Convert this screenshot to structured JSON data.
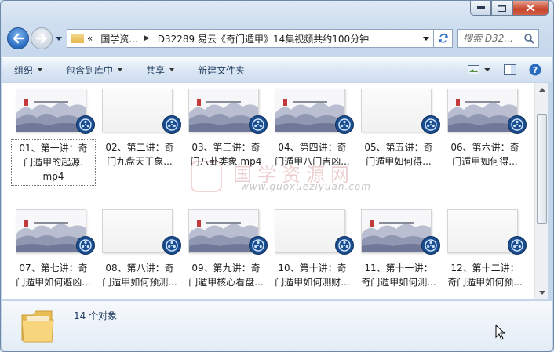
{
  "window": {
    "colors": {
      "frame": "#c4d6ec",
      "accent": "#2a6bc2",
      "close": "#c7442b",
      "badge": "#1a4d8f"
    }
  },
  "address": {
    "overflow": "«",
    "crumbs": [
      "国学资...",
      "D32289 易云《奇门遁甲》14集视频共约100分钟"
    ]
  },
  "search": {
    "placeholder": "搜索 D32..."
  },
  "toolbar": {
    "organize": "组织",
    "include_in_library": "包含到库中",
    "share": "共享",
    "new_folder": "新建文件夹"
  },
  "watermark": {
    "title": "国学资源网",
    "url": "www.guoxueziyuan.com"
  },
  "files": [
    {
      "name": "01、第一讲：奇门遁甲的起源.mp4",
      "line1": "01、第一讲：奇",
      "line2": "门遁甲的起源.",
      "line3": "mp4",
      "thumb": "landscape",
      "selected": true
    },
    {
      "name": "02、第二讲：奇门九盘天干象...",
      "line1": "02、第二讲：奇",
      "line2": "门九盘天干象...",
      "line3": "",
      "thumb": "blank",
      "selected": false
    },
    {
      "name": "03、第三讲：奇门八卦类象.mp4",
      "line1": "03、第三讲：奇",
      "line2": "门八卦类象.mp4",
      "line3": "",
      "thumb": "landscape",
      "selected": false
    },
    {
      "name": "04、第四讲：奇门遁甲八门吉凶...",
      "line1": "04、第四讲：奇",
      "line2": "门遁甲八门吉凶...",
      "line3": "",
      "thumb": "landscape",
      "selected": false
    },
    {
      "name": "05、第五讲：奇门遁甲如何得...",
      "line1": "05、第五讲：奇",
      "line2": "门遁甲如何得...",
      "line3": "",
      "thumb": "blank",
      "selected": false
    },
    {
      "name": "06、第六讲：奇门遁甲如何得...",
      "line1": "06、第六讲：奇",
      "line2": "门遁甲如何得...",
      "line3": "",
      "thumb": "landscape",
      "selected": false
    },
    {
      "name": "07、第七讲：奇门遁甲如何避凶...",
      "line1": "07、第七讲：奇",
      "line2": "门遁甲如何避凶...",
      "line3": "",
      "thumb": "landscape",
      "selected": false
    },
    {
      "name": "08、第八讲：奇门遁甲如何预测...",
      "line1": "08、第八讲：奇",
      "line2": "门遁甲如何预测...",
      "line3": "",
      "thumb": "blank",
      "selected": false
    },
    {
      "name": "09、第九讲：奇门遁甲核心看盘...",
      "line1": "09、第九讲：奇",
      "line2": "门遁甲核心看盘...",
      "line3": "",
      "thumb": "landscape",
      "selected": false
    },
    {
      "name": "10、第十讲：奇门遁甲如何测财...",
      "line1": "10、第十讲：奇",
      "line2": "门遁甲如何测财...",
      "line3": "",
      "thumb": "blank",
      "selected": false
    },
    {
      "name": "11、第十一讲：奇门遁甲如何测...",
      "line1": "11、第十一讲：",
      "line2": "奇门遁甲如何测...",
      "line3": "",
      "thumb": "landscape",
      "selected": false
    },
    {
      "name": "12、第十二讲：奇门遁甲如何预...",
      "line1": "12、第十二讲：",
      "line2": "奇门遁甲如何预...",
      "line3": "",
      "thumb": "blank",
      "selected": false
    }
  ],
  "details": {
    "count": "14 个对象"
  }
}
